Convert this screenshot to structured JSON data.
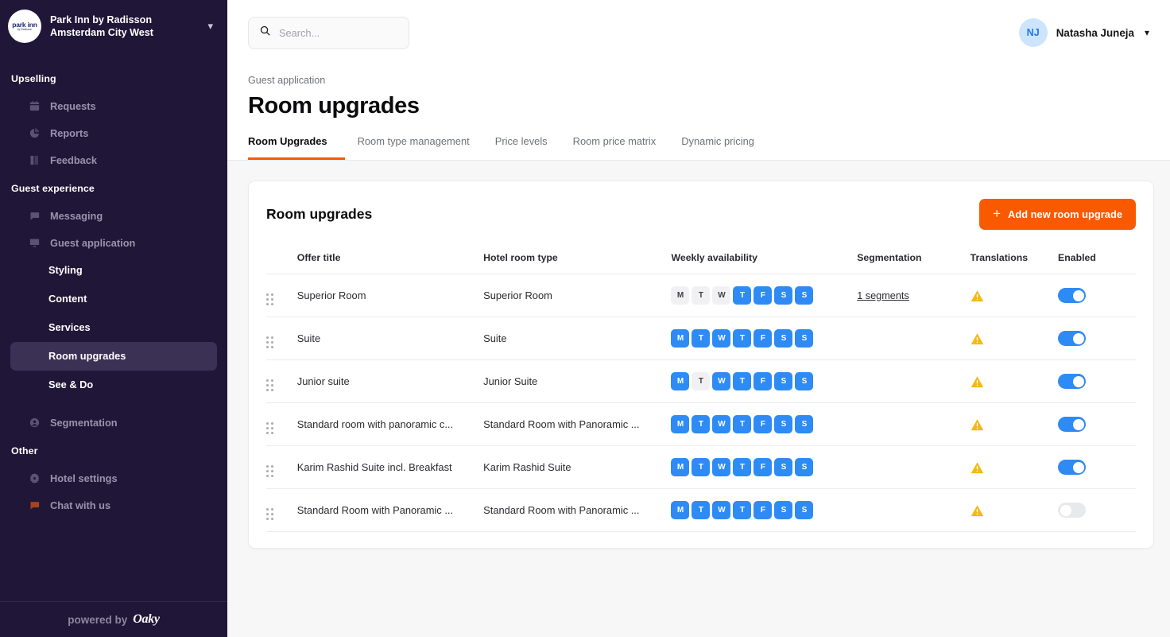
{
  "sidebar": {
    "hotel": {
      "name_line1": "Park Inn by Radisson",
      "name_line2": "Amsterdam City West",
      "logo_text": "park inn",
      "logo_sub": "by Radisson"
    },
    "groups": [
      {
        "label": "Upselling",
        "items": [
          {
            "label": "Requests",
            "icon": "calendar-icon"
          },
          {
            "label": "Reports",
            "icon": "pie-chart-icon"
          },
          {
            "label": "Feedback",
            "icon": "book-icon"
          }
        ]
      },
      {
        "label": "Guest experience",
        "items": [
          {
            "label": "Messaging",
            "icon": "chat-bubble-icon"
          },
          {
            "label": "Guest application",
            "icon": "monitor-icon"
          },
          {
            "label": "Segmentation",
            "icon": "user-circle-icon"
          }
        ],
        "sub_items": [
          {
            "label": "Styling",
            "active": false
          },
          {
            "label": "Content",
            "active": false
          },
          {
            "label": "Services",
            "active": false
          },
          {
            "label": "Room upgrades",
            "active": true
          },
          {
            "label": "See & Do",
            "active": false
          }
        ]
      },
      {
        "label": "Other",
        "items": [
          {
            "label": "Hotel settings",
            "icon": "gear-icon"
          },
          {
            "label": "Chat with us",
            "icon": "chat-with-us-icon"
          }
        ]
      }
    ],
    "footer": {
      "powered_by": "powered by",
      "brand": "Oaky"
    }
  },
  "topbar": {
    "search_placeholder": "Search...",
    "search_value": "",
    "user_initials": "NJ",
    "user_name": "Natasha Juneja"
  },
  "page": {
    "breadcrumb": "Guest application",
    "title": "Room upgrades"
  },
  "tabs": [
    {
      "label": "Room Upgrades",
      "active": true
    },
    {
      "label": "Room type management",
      "active": false
    },
    {
      "label": "Price levels",
      "active": false
    },
    {
      "label": "Room price matrix",
      "active": false
    },
    {
      "label": "Dynamic pricing",
      "active": false
    }
  ],
  "card": {
    "title": "Room upgrades",
    "add_button": "Add new room upgrade",
    "columns": [
      "",
      "Offer title",
      "Hotel room type",
      "Weekly availability",
      "Segmentation",
      "Translations",
      "Enabled"
    ],
    "day_labels": [
      "M",
      "T",
      "W",
      "T",
      "F",
      "S",
      "S"
    ],
    "rows": [
      {
        "offer_title": "Superior Room",
        "hotel_room_type": "Superior Room",
        "days": [
          false,
          false,
          false,
          true,
          true,
          true,
          true
        ],
        "segmentation": "1 segments",
        "translations_warning": true,
        "enabled": true
      },
      {
        "offer_title": "Suite",
        "hotel_room_type": "Suite",
        "days": [
          true,
          true,
          true,
          true,
          true,
          true,
          true
        ],
        "segmentation": "",
        "translations_warning": true,
        "enabled": true
      },
      {
        "offer_title": "Junior suite",
        "hotel_room_type": "Junior Suite",
        "days": [
          true,
          false,
          true,
          true,
          true,
          true,
          true
        ],
        "segmentation": "",
        "translations_warning": true,
        "enabled": true
      },
      {
        "offer_title": "Standard room with panoramic c...",
        "hotel_room_type": "Standard Room with Panoramic ...",
        "days": [
          true,
          true,
          true,
          true,
          true,
          true,
          true
        ],
        "segmentation": "",
        "translations_warning": true,
        "enabled": true
      },
      {
        "offer_title": "Karim Rashid Suite incl. Breakfast",
        "hotel_room_type": "Karim Rashid Suite",
        "days": [
          true,
          true,
          true,
          true,
          true,
          true,
          true
        ],
        "segmentation": "",
        "translations_warning": true,
        "enabled": true
      },
      {
        "offer_title": "Standard Room with Panoramic ...",
        "hotel_room_type": "Standard Room with Panoramic ...",
        "days": [
          true,
          true,
          true,
          true,
          true,
          true,
          true
        ],
        "segmentation": "",
        "translations_warning": true,
        "enabled": false
      }
    ]
  },
  "colors": {
    "sidebar_bg": "#201637",
    "accent_orange": "#f95a00",
    "toggle_blue": "#2e8bf5",
    "warning_yellow": "#f5b911"
  }
}
